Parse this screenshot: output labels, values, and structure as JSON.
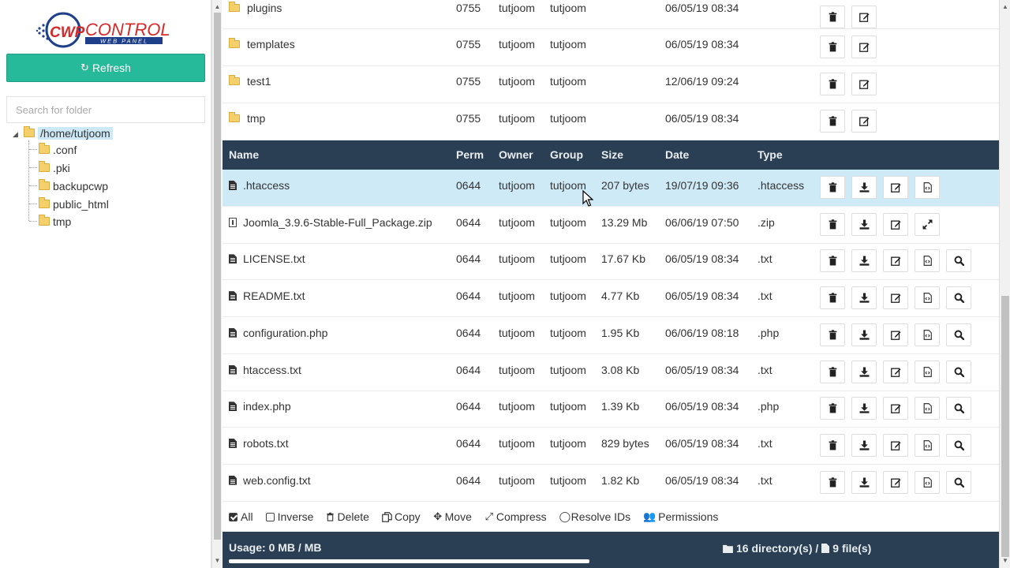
{
  "sidebar": {
    "logo_text": "CONTROL",
    "logo_sub": "WEB PANEL",
    "logo_mark": "CWP",
    "refresh_label": "Refresh",
    "search_placeholder": "Search for folder",
    "tree": {
      "root": "/home/tutjoom",
      "children": [
        ".conf",
        ".pki",
        "backupcwp",
        "public_html",
        "tmp"
      ]
    }
  },
  "directories": [
    {
      "name": "plugins",
      "perm": "0755",
      "owner": "tutjoom",
      "group": "tutjoom",
      "date": "06/05/19 08:34"
    },
    {
      "name": "templates",
      "perm": "0755",
      "owner": "tutjoom",
      "group": "tutjoom",
      "date": "06/05/19 08:34"
    },
    {
      "name": "test1",
      "perm": "0755",
      "owner": "tutjoom",
      "group": "tutjoom",
      "date": "12/06/19 09:24"
    },
    {
      "name": "tmp",
      "perm": "0755",
      "owner": "tutjoom",
      "group": "tutjoom",
      "date": "06/05/19 08:34"
    }
  ],
  "columns": {
    "name": "Name",
    "perm": "Perm",
    "owner": "Owner",
    "group": "Group",
    "size": "Size",
    "date": "Date",
    "type": "Type"
  },
  "files": [
    {
      "name": ".htaccess",
      "perm": "0644",
      "owner": "tutjoom",
      "group": "tutjoom",
      "size": "207 bytes",
      "date": "19/07/19 09:36",
      "type": ".htaccess"
    },
    {
      "name": "Joomla_3.9.6-Stable-Full_Package.zip",
      "perm": "0644",
      "owner": "tutjoom",
      "group": "tutjoom",
      "size": "13.29 Mb",
      "date": "06/06/19 07:50",
      "type": ".zip"
    },
    {
      "name": "LICENSE.txt",
      "perm": "0644",
      "owner": "tutjoom",
      "group": "tutjoom",
      "size": "17.67 Kb",
      "date": "06/05/19 08:34",
      "type": ".txt"
    },
    {
      "name": "README.txt",
      "perm": "0644",
      "owner": "tutjoom",
      "group": "tutjoom",
      "size": "4.77 Kb",
      "date": "06/05/19 08:34",
      "type": ".txt"
    },
    {
      "name": "configuration.php",
      "perm": "0644",
      "owner": "tutjoom",
      "group": "tutjoom",
      "size": "1.95 Kb",
      "date": "06/06/19 08:18",
      "type": ".php"
    },
    {
      "name": "htaccess.txt",
      "perm": "0644",
      "owner": "tutjoom",
      "group": "tutjoom",
      "size": "3.08 Kb",
      "date": "06/05/19 08:34",
      "type": ".txt"
    },
    {
      "name": "index.php",
      "perm": "0644",
      "owner": "tutjoom",
      "group": "tutjoom",
      "size": "1.39 Kb",
      "date": "06/05/19 08:34",
      "type": ".php"
    },
    {
      "name": "robots.txt",
      "perm": "0644",
      "owner": "tutjoom",
      "group": "tutjoom",
      "size": "829 bytes",
      "date": "06/05/19 08:34",
      "type": ".txt"
    },
    {
      "name": "web.config.txt",
      "perm": "0644",
      "owner": "tutjoom",
      "group": "tutjoom",
      "size": "1.82 Kb",
      "date": "06/05/19 08:34",
      "type": ".txt"
    }
  ],
  "actions": {
    "all": "All",
    "inverse": "Inverse",
    "delete": "Delete",
    "copy": "Copy",
    "move": "Move",
    "compress": "Compress",
    "resolve": "Resolve IDs",
    "permissions": "Permissions"
  },
  "footer": {
    "usage": "Usage: 0 MB / MB",
    "dirs": "16 directory(s) /",
    "files": "9 file(s)"
  },
  "colors": {
    "accent": "#26b99a",
    "header": "#2a3f54",
    "highlight": "#cfeaf7"
  }
}
